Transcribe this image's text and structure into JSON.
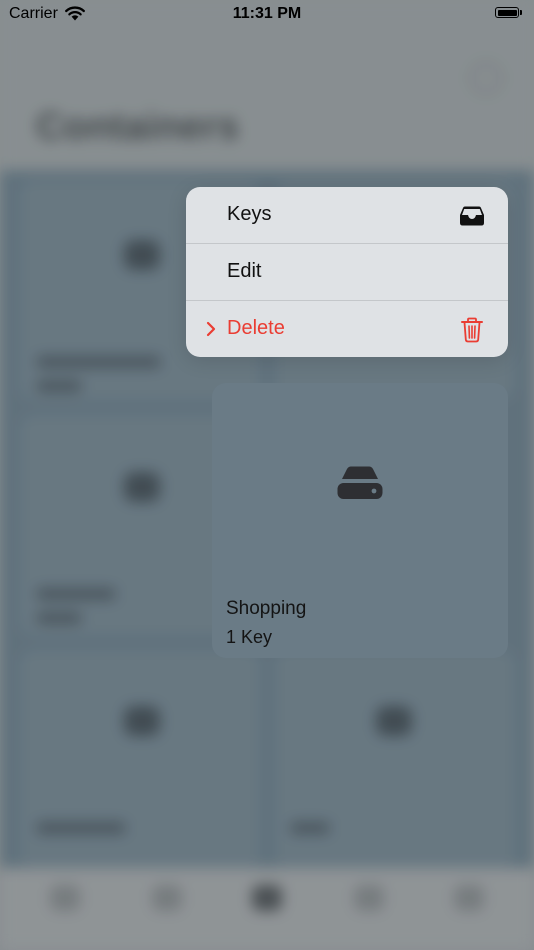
{
  "status_bar": {
    "carrier": "Carrier",
    "time": "11:31 PM"
  },
  "background": {
    "title": "Containers"
  },
  "context_menu": {
    "items": [
      {
        "label": "Keys",
        "icon": "tray-icon"
      },
      {
        "label": "Edit"
      },
      {
        "label": "Delete",
        "icon": "trash-icon",
        "destructive": true
      }
    ]
  },
  "preview": {
    "title": "Shopping",
    "subtitle": "1 Key",
    "icon": "drive-icon"
  },
  "colors": {
    "destructive": "#ea3d33",
    "card": "#6a7b86",
    "menu": "#dfe2e5"
  }
}
